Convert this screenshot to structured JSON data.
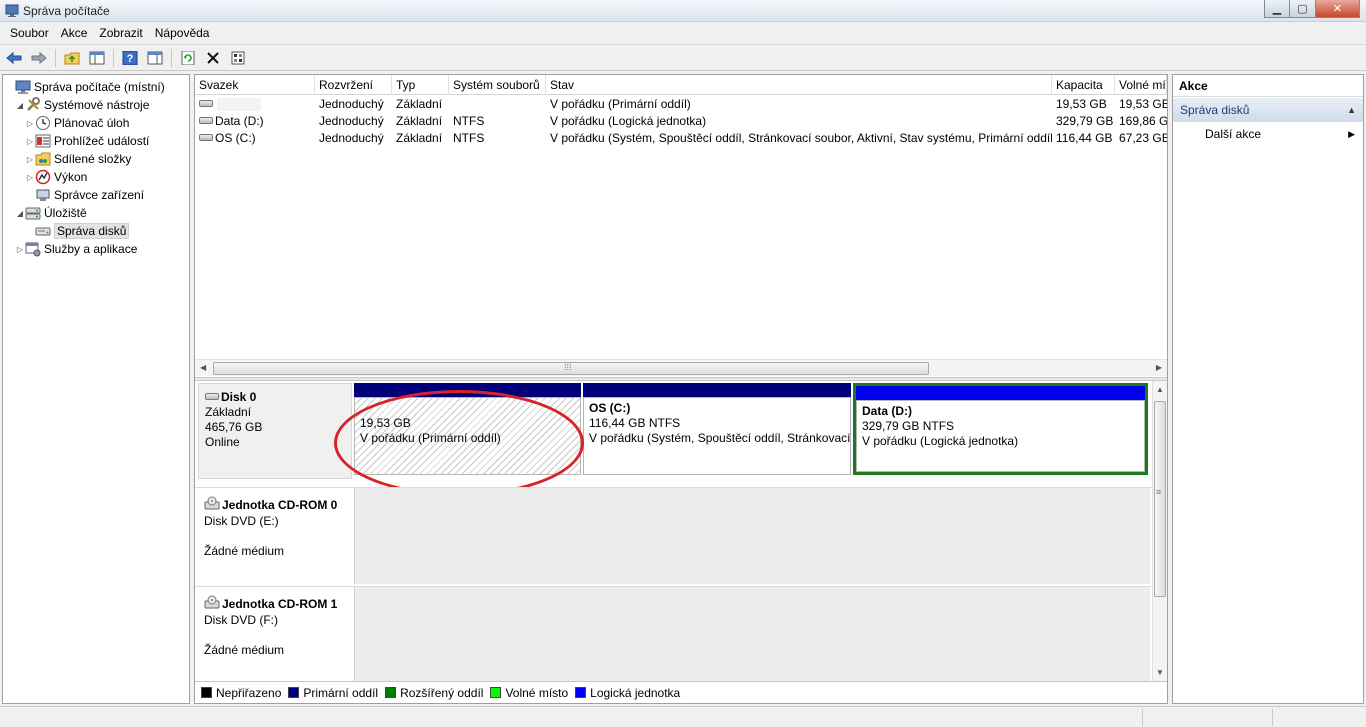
{
  "window": {
    "title": "Správa počítače"
  },
  "menu": [
    "Soubor",
    "Akce",
    "Zobrazit",
    "Nápověda"
  ],
  "toolbar": {
    "icons": [
      "back-arrow-icon",
      "forward-arrow-icon",
      "up-folder-icon",
      "show-hide-tree-icon",
      "help-icon",
      "show-hide-action-pane-icon",
      "refresh-icon",
      "delete-icon",
      "properties-icon"
    ]
  },
  "tree": {
    "items": [
      {
        "label": "Správa počítače (místní)",
        "level": 0,
        "expander": "",
        "icon": "computer-management-icon"
      },
      {
        "label": "Systémové nástroje",
        "level": 1,
        "expander": "◢",
        "icon": "tools-icon"
      },
      {
        "label": "Plánovač úloh",
        "level": 2,
        "expander": "▷",
        "icon": "clock-icon"
      },
      {
        "label": "Prohlížeč událostí",
        "level": 2,
        "expander": "▷",
        "icon": "event-viewer-icon"
      },
      {
        "label": "Sdílené složky",
        "level": 2,
        "expander": "▷",
        "icon": "shared-folder-icon"
      },
      {
        "label": "Výkon",
        "level": 2,
        "expander": "▷",
        "icon": "performance-icon"
      },
      {
        "label": "Správce zařízení",
        "level": 2,
        "expander": "",
        "icon": "device-manager-icon"
      },
      {
        "label": "Úložiště",
        "level": 1,
        "expander": "◢",
        "icon": "storage-icon"
      },
      {
        "label": "Správa disků",
        "level": 2,
        "expander": "",
        "icon": "disk-management-icon",
        "selected": true
      },
      {
        "label": "Služby a aplikace",
        "level": 1,
        "expander": "▷",
        "icon": "services-icon"
      }
    ]
  },
  "volumes": {
    "columns": [
      "Svazek",
      "Rozvržení",
      "Typ",
      "Systém souborů",
      "Stav",
      "Kapacita",
      "Volné mí"
    ],
    "rows": [
      [
        "",
        "Jednoduchý",
        "Základní",
        "",
        "V pořádku (Primární oddíl)",
        "19,53 GB",
        "19,53 GB"
      ],
      [
        "Data (D:)",
        "Jednoduchý",
        "Základní",
        "NTFS",
        "V pořádku (Logická jednotka)",
        "329,79 GB",
        "169,86 G"
      ],
      [
        "OS (C:)",
        "Jednoduchý",
        "Základní",
        "NTFS",
        "V pořádku (Systém, Spouštěcí oddíl, Stránkovací soubor, Aktivní, Stav systému, Primární oddíl)",
        "116,44 GB",
        "67,23 GB"
      ]
    ]
  },
  "disks": [
    {
      "name": "Disk 0",
      "type": "Základní",
      "size": "465,76 GB",
      "status": "Online",
      "partitions": [
        {
          "name": "",
          "size": "19,53 GB",
          "status": "V pořádku (Primární oddíl)"
        },
        {
          "name": "OS  (C:)",
          "size": "116,44 GB NTFS",
          "status": "V pořádku (Systém, Spouštěcí oddíl, Stránkovací"
        },
        {
          "name": "Data  (D:)",
          "size": "329,79 GB NTFS",
          "status": "V pořádku (Logická jednotka)"
        }
      ]
    },
    {
      "name": "Jednotka CD-ROM 0",
      "type": "Disk DVD (E:)",
      "media": "Žádné médium"
    },
    {
      "name": "Jednotka CD-ROM 1",
      "type": "Disk DVD (F:)",
      "media": "Žádné médium"
    }
  ],
  "legend": [
    {
      "label": "Nepřiřazeno",
      "color": "#000000"
    },
    {
      "label": "Primární oddíl",
      "color": "#000080"
    },
    {
      "label": "Rozšířený oddíl",
      "color": "#008000"
    },
    {
      "label": "Volné místo",
      "color": "#00ff00"
    },
    {
      "label": "Logická jednotka",
      "color": "#0000ff"
    }
  ],
  "actions": {
    "header": "Akce",
    "section": "Správa disků",
    "items": [
      "Další akce"
    ]
  },
  "colors": {
    "primary_bar": "#00007a",
    "logical_bar": "#0000ee",
    "selected_border": "#1f7a1f",
    "annotation": "#d8222a"
  }
}
